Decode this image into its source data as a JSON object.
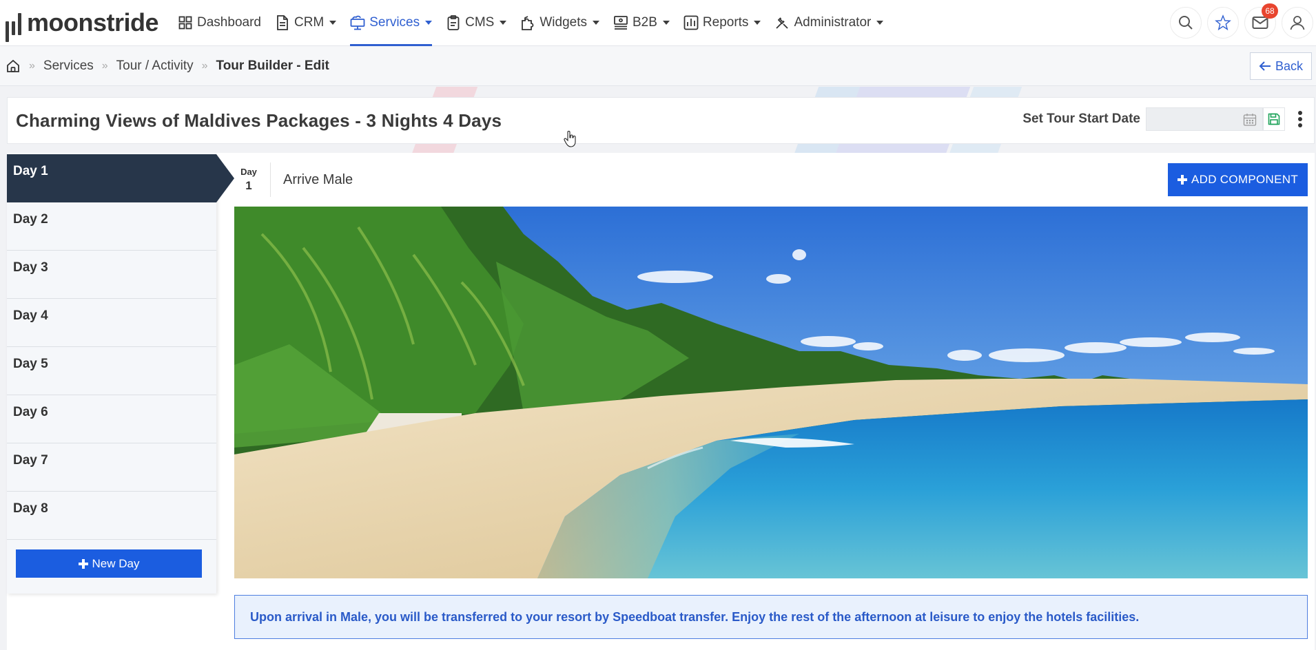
{
  "app": {
    "brand": "moonstride"
  },
  "nav": {
    "items": [
      {
        "label": "Dashboard",
        "icon": "grid-icon",
        "has_caret": false,
        "active": false
      },
      {
        "label": "CRM",
        "icon": "document-icon",
        "has_caret": true,
        "active": false
      },
      {
        "label": "Services",
        "icon": "services-icon",
        "has_caret": true,
        "active": true
      },
      {
        "label": "CMS",
        "icon": "clipboard-icon",
        "has_caret": true,
        "active": false
      },
      {
        "label": "Widgets",
        "icon": "puzzle-icon",
        "has_caret": true,
        "active": false
      },
      {
        "label": "B2B",
        "icon": "money-icon",
        "has_caret": true,
        "active": false
      },
      {
        "label": "Reports",
        "icon": "bar-chart-icon",
        "has_caret": true,
        "active": false
      },
      {
        "label": "Administrator",
        "icon": "tools-icon",
        "has_caret": true,
        "active": false
      }
    ],
    "right": {
      "mail_badge": "68"
    }
  },
  "breadcrumb": {
    "items": [
      "Services",
      "Tour / Activity"
    ],
    "current": "Tour Builder - Edit",
    "back_label": "Back"
  },
  "tour": {
    "title": "Charming Views of Maldives Packages - 3 Nights 4 Days",
    "start_date_label": "Set Tour Start Date",
    "start_date_value": ""
  },
  "days": {
    "items": [
      "Day 1",
      "Day 2",
      "Day 3",
      "Day 4",
      "Day 5",
      "Day 6",
      "Day 7",
      "Day 8"
    ],
    "active_index": 0,
    "new_day_label": "New Day"
  },
  "day_detail": {
    "badge_label": "Day",
    "badge_number": "1",
    "title": "Arrive Male",
    "add_component_label": "ADD COMPONENT",
    "image_alt": "Tropical beach with palm trees and turquoise sea",
    "description": "Upon arrival in Male, you will be transferred to your resort by Speedboat transfer. Enjoy the rest of the afternoon at leisure to enjoy the hotels facilities."
  },
  "colors": {
    "accent": "#1b5de0",
    "nav_active": "#2f5fd0",
    "day_active_bg": "#27364a",
    "badge": "#e8452f",
    "desc_bg": "#e9f1fd",
    "desc_text": "#2a5ac8"
  }
}
